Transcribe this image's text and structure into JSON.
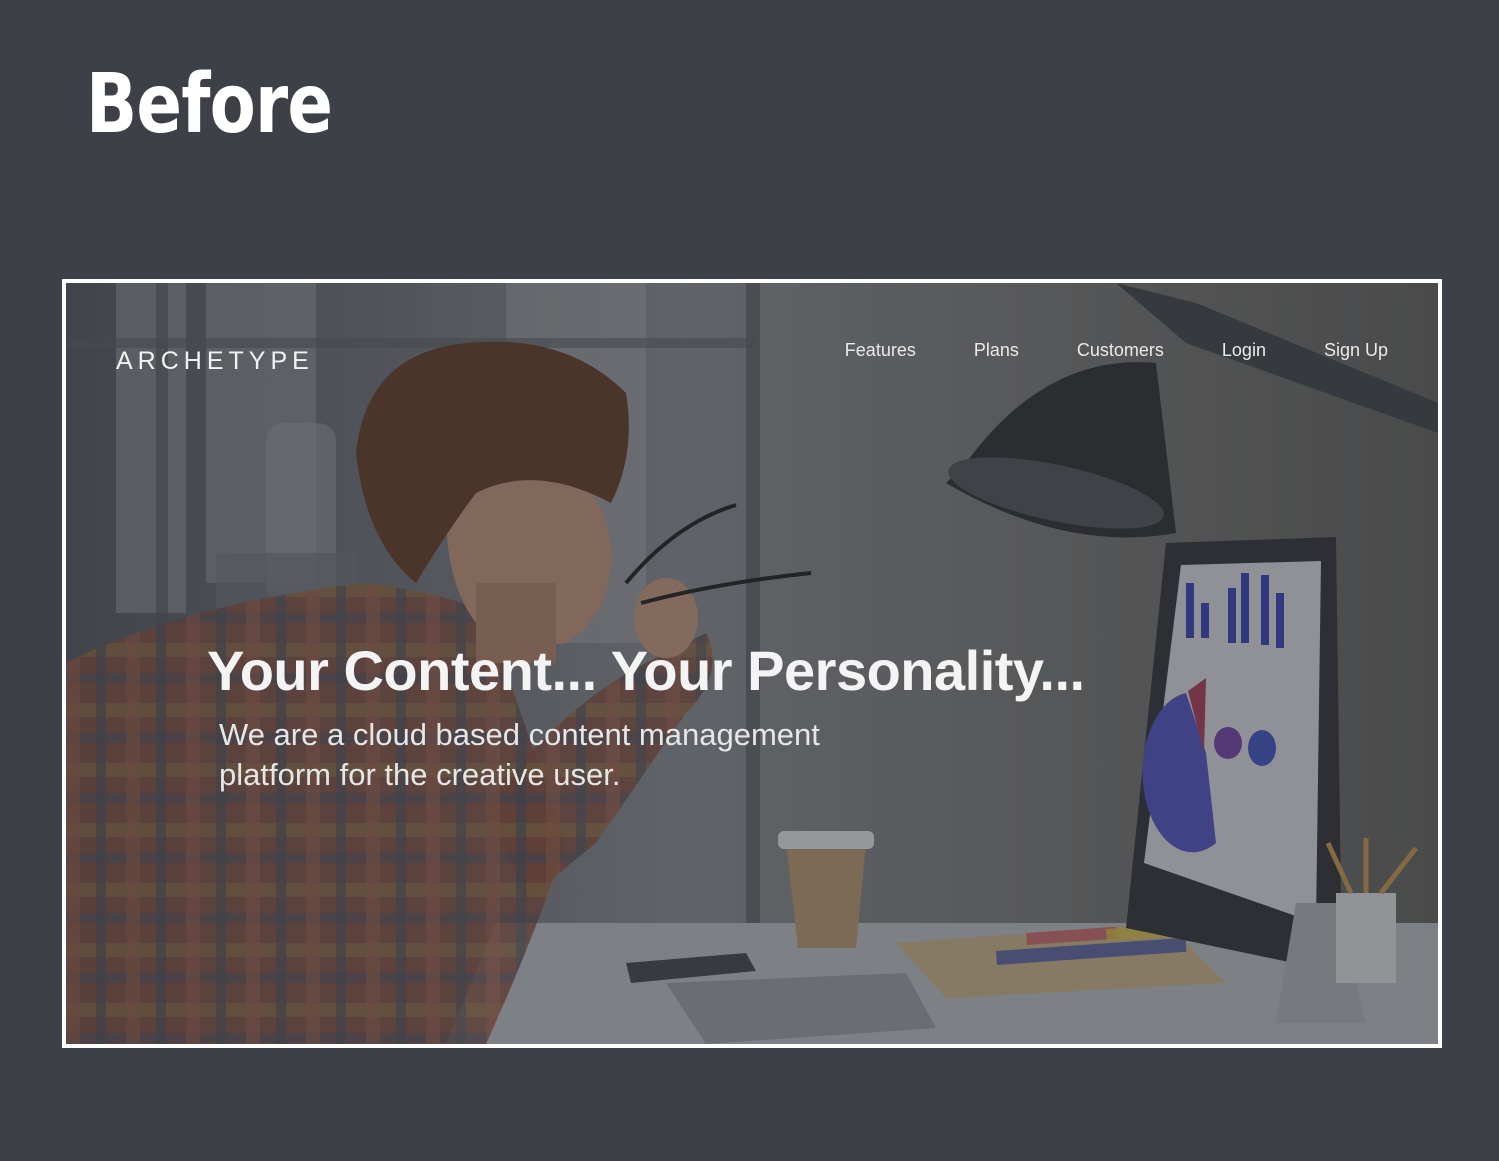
{
  "slide": {
    "title": "Before"
  },
  "site": {
    "brand": "ARCHETYPE",
    "nav": [
      "Features",
      "Plans",
      "Customers",
      "Login",
      "Sign Up"
    ],
    "hero": {
      "title": "Your Content... Your Personality...",
      "subtitle": "We are a cloud based content management platform for the creative user."
    }
  },
  "colors": {
    "background": "#3d4046",
    "frame_border": "#ffffff",
    "text": "#ffffff"
  }
}
